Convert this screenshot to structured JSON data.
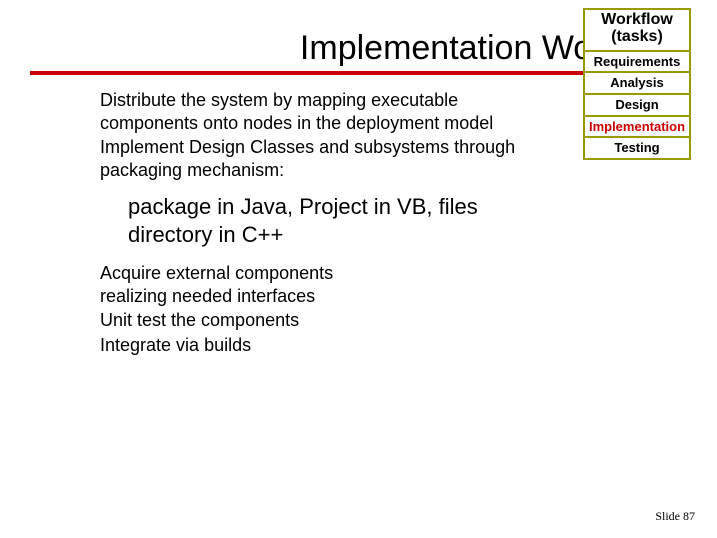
{
  "title": "Implementation Workflow",
  "workflow": {
    "header": "Workflow (tasks)",
    "items": [
      {
        "label": "Requirements",
        "current": false
      },
      {
        "label": "Analysis",
        "current": false
      },
      {
        "label": "Design",
        "current": false
      },
      {
        "label": "Implementation",
        "current": true
      },
      {
        "label": "Testing",
        "current": false
      }
    ]
  },
  "body": {
    "p1": "Distribute the system by mapping executable components onto nodes in the deployment model",
    "p2": "Implement Design Classes and subsystems through packaging mechanism:",
    "sub": "package in Java, Project in VB, files directory in C++",
    "p3": "Acquire external components realizing needed interfaces",
    "p4": "Unit test the components",
    "p5": "Integrate via builds"
  },
  "footer": {
    "label": "Slide",
    "number": "87"
  }
}
